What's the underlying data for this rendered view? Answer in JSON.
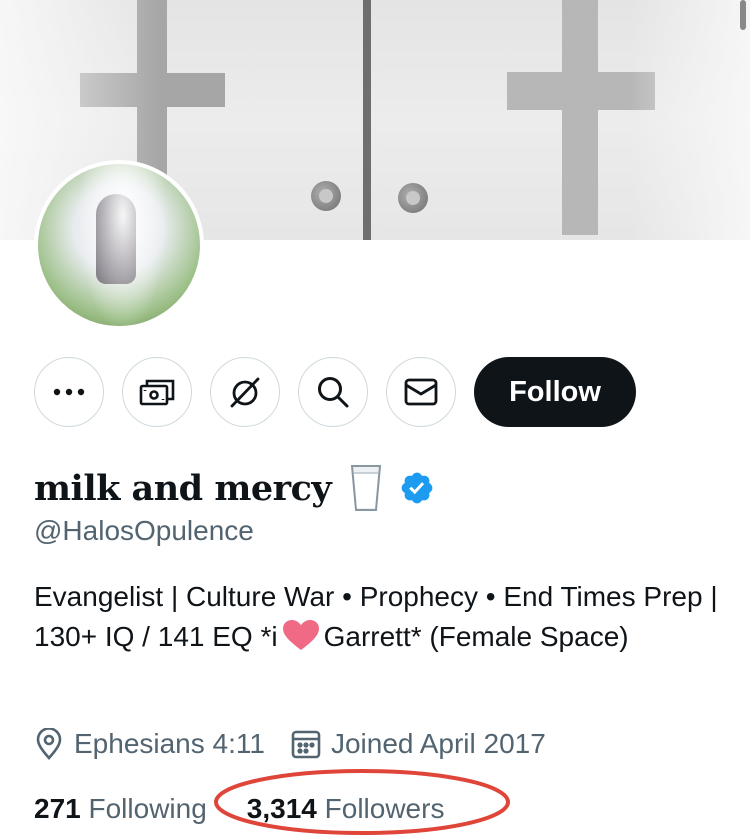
{
  "profile": {
    "display_name": "milk and mercy",
    "handle": "@HalosOpulence",
    "verified_color": "#1d9bf0"
  },
  "actions": {
    "more_icon": "more-dots-icon",
    "subscribe_icon": "money-icon",
    "grok_icon": "grok-icon",
    "search_icon": "search-icon",
    "message_icon": "envelope-icon",
    "follow_label": "Follow"
  },
  "bio": {
    "line_part1": "Evangelist | Culture War • Prophecy • End Times Prep | 130+ IQ / 141 EQ *i",
    "line_part2": "Garrett* (Female Space)"
  },
  "meta": {
    "location": "Ephesians 4:11",
    "joined": "Joined April 2017"
  },
  "stats": {
    "following_count": "271",
    "following_label": "Following",
    "followers_count": "3,314",
    "followers_label": "Followers"
  },
  "colors": {
    "text_primary": "#0f1419",
    "text_secondary": "#536471",
    "annotation_circle": "#e0453a"
  }
}
